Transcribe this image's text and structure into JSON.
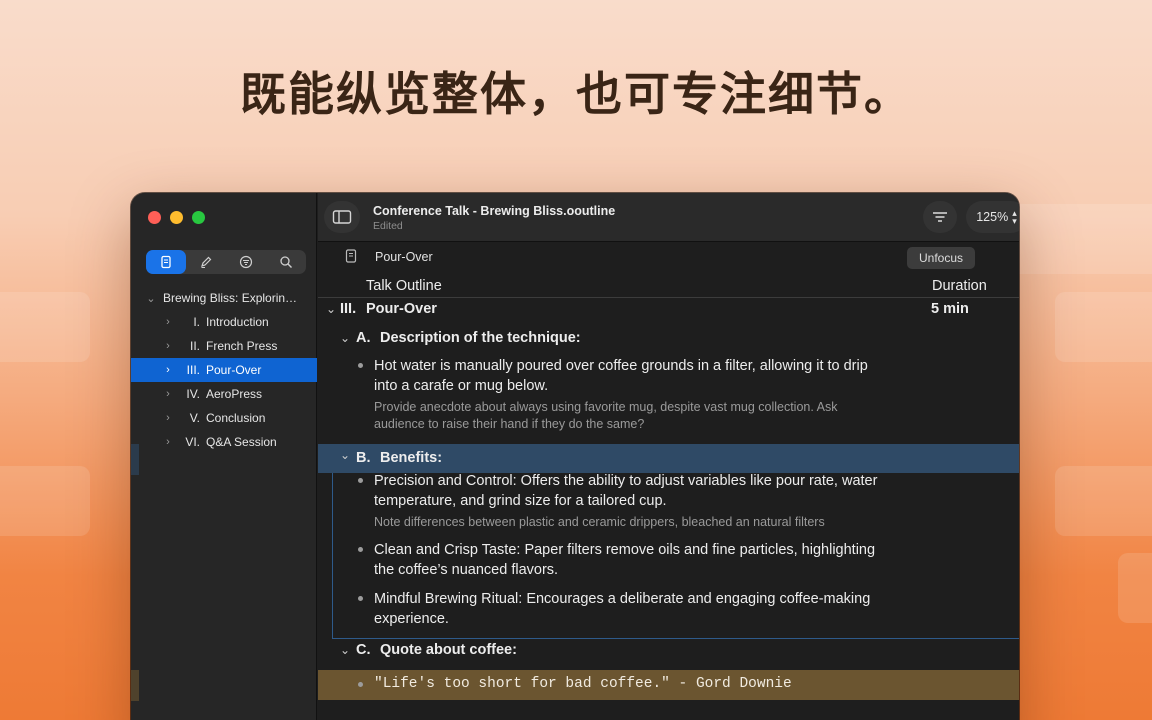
{
  "headline": "既能纵览整体，也可专注细节。",
  "window": {
    "title": "Conference Talk - Brewing Bliss.ooutline",
    "status": "Edited",
    "zoom": "125%",
    "zoom_chevron": "⌃⌄"
  },
  "sidebar": {
    "tabs": [
      {
        "name": "outline-tab",
        "icon": "document-icon",
        "active": true
      },
      {
        "name": "inspector-tab",
        "icon": "pen-icon",
        "active": false
      },
      {
        "name": "filter-tab",
        "icon": "filter-icon",
        "active": false
      },
      {
        "name": "search-tab",
        "icon": "search-icon",
        "active": false
      }
    ],
    "root": {
      "label": "Brewing Bliss: Explorin…"
    },
    "items": [
      {
        "num": "I.",
        "label": "Introduction"
      },
      {
        "num": "II.",
        "label": "French Press"
      },
      {
        "num": "III.",
        "label": "Pour-Over",
        "selected": true
      },
      {
        "num": "IV.",
        "label": "AeroPress"
      },
      {
        "num": "V.",
        "label": "Conclusion"
      },
      {
        "num": "VI.",
        "label": "Q&A Session"
      }
    ]
  },
  "focus": {
    "label": "Pour-Over",
    "unfocus_label": "Unfocus"
  },
  "columns": {
    "outline": "Talk Outline",
    "duration": "Duration"
  },
  "outline": {
    "section": {
      "num": "III.",
      "title": "Pour-Over",
      "duration": "5 min"
    },
    "a": {
      "num": "A.",
      "title": "Description of the technique:",
      "item1_line1": "Hot water is manually poured over coffee grounds in a filter, allowing it to drip",
      "item1_line2": "into a carafe or mug below.",
      "note1_line1": "Provide anecdote about always using favorite mug, despite vast mug collection. Ask",
      "note1_line2": "audience to raise their hand if they do the same?"
    },
    "b": {
      "num": "B.",
      "title": "Benefits:",
      "item1_line1": "Precision and Control: Offers the ability to adjust variables like pour rate, water",
      "item1_line2": "temperature, and grind size for a tailored cup.",
      "note1": "Note differences between plastic and ceramic drippers, bleached an natural filters",
      "item2_line1": "Clean and Crisp Taste: Paper filters remove oils and fine particles, highlighting",
      "item2_line2": "the coffee’s nuanced flavors.",
      "item3_line1": "Mindful Brewing Ritual: Encourages a deliberate and engaging coffee-making",
      "item3_line2": "experience."
    },
    "c": {
      "num": "C.",
      "title": "Quote about coffee:",
      "quote": "\"Life's too short for bad coffee.\" - Gord Downie"
    }
  },
  "colors": {
    "accent": "#1a73e8",
    "selection": "#0f64d2",
    "focus_band": "#2f4a66",
    "quote_band": "#6b5530"
  }
}
